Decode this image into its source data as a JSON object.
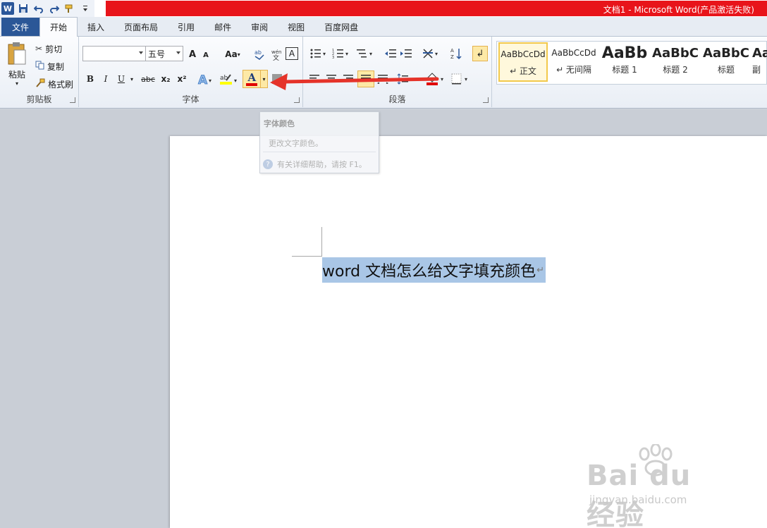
{
  "titlebar": {
    "title": "文档1 - Microsoft Word(产品激活失败)",
    "qat_icons": [
      "word-logo-icon",
      "save-icon",
      "undo-icon",
      "redo-icon",
      "format-painter-icon",
      "customize-icon"
    ],
    "word_logo": "W"
  },
  "tabs": [
    "文件",
    "开始",
    "插入",
    "页面布局",
    "引用",
    "邮件",
    "审阅",
    "视图",
    "百度网盘"
  ],
  "clipboard": {
    "paste": "粘贴",
    "cut": "剪切",
    "copy": "复制",
    "format_painter": "格式刷",
    "label": "剪贴板"
  },
  "font": {
    "font_name": "",
    "font_size": "五号",
    "grow": "A",
    "shrink": "A",
    "change_case": "Aa",
    "bold": "B",
    "italic": "I",
    "underline": "U",
    "strikethrough": "abc",
    "subscript": "x₂",
    "superscript": "x²",
    "font_color_letter": "A",
    "label": "字体",
    "font_color_accent": "#e00000"
  },
  "paragraph": {
    "label": "段落"
  },
  "styles": {
    "items": [
      {
        "sample": "AaBbCcDd",
        "name": "↵ 正文"
      },
      {
        "sample": "AaBbCcDd",
        "name": "↵ 无间隔"
      },
      {
        "sample": "AaBb",
        "name": "标题 1"
      },
      {
        "sample": "AaBbC",
        "name": "标题 2"
      },
      {
        "sample": "AaBbC",
        "name": "标题"
      },
      {
        "sample": "Aa",
        "name": "副"
      }
    ]
  },
  "tooltip": {
    "title": "字体颜色",
    "description": "更改文字颜色。",
    "help": "有关详细帮助，请按 F1。",
    "help_icon": "?"
  },
  "document": {
    "text": "word 文档怎么给文字填充颜色",
    "paragraph_mark": "↵"
  },
  "watermark": {
    "brand": "Bai du 经验",
    "url": "jingyan.baidu.com"
  }
}
